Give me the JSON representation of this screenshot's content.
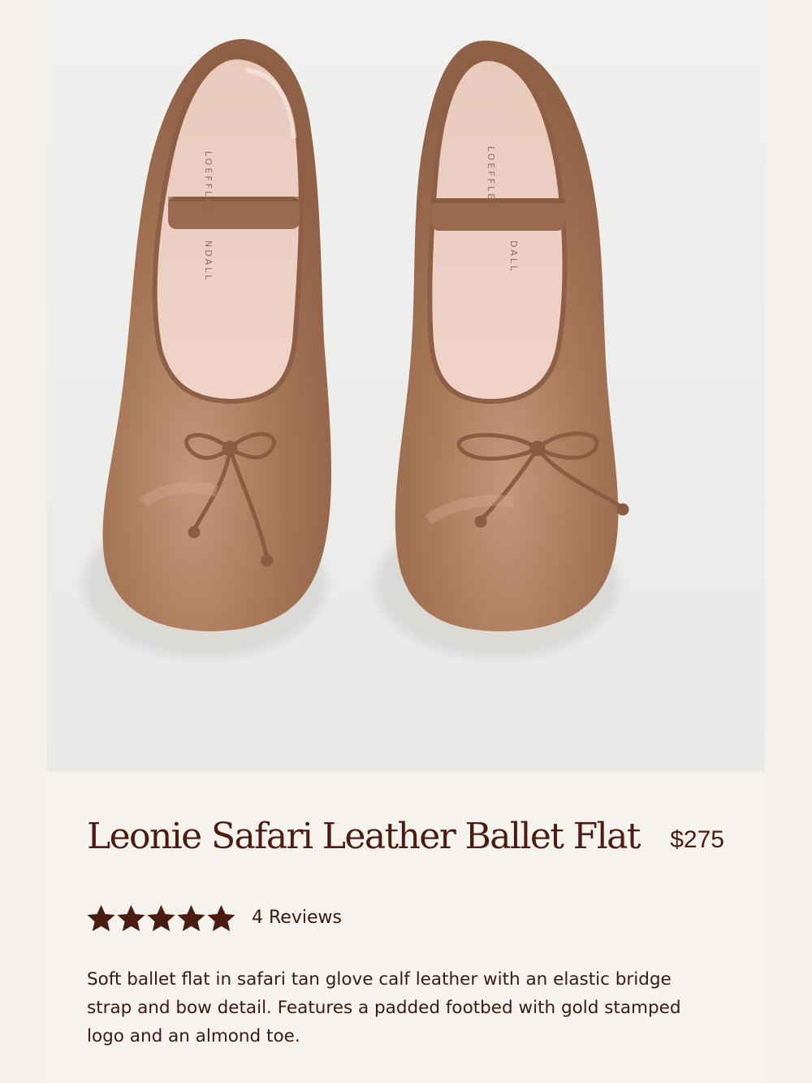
{
  "product": {
    "title": "Leonie Safari Leather Ballet Flat",
    "price": "$275",
    "rating": 5,
    "rating_max": 5,
    "reviews_label": "4 Reviews",
    "description": "Soft ballet flat in safari tan glove calf leather with an elastic bridge strap and bow detail. Features a padded footbed with gold stamped logo and an almond toe."
  },
  "image": {
    "insole_text_left_top": "LOEFFLER",
    "insole_text_left_bottom": "NDALL",
    "insole_text_right_top": "LOEFFLER",
    "insole_text_right_bottom": "DALL"
  },
  "colors": {
    "text_dark": "#4a1d10",
    "star": "#4a1d10",
    "leather": "#a87658",
    "insole": "#eac8bb",
    "photo_bg": "#ececeb",
    "panel_bg": "#f6f2ed"
  },
  "icons": {
    "rating_star": "star-icon"
  }
}
